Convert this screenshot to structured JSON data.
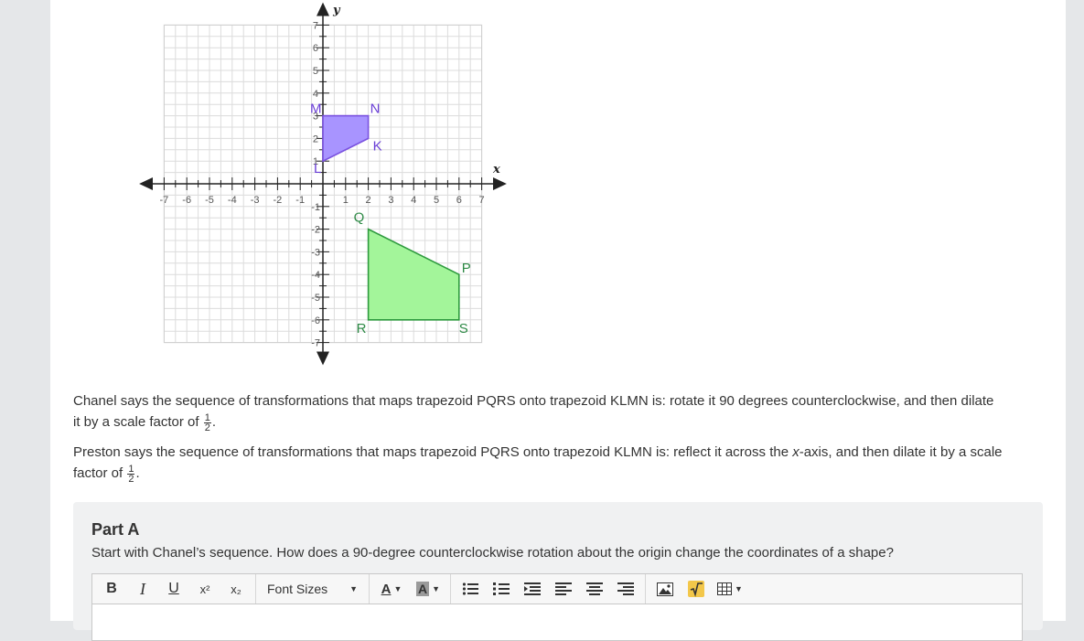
{
  "graph": {
    "axis_x_name": "x",
    "axis_y_name": "y",
    "x_ticks": [
      "-7",
      "-6",
      "-5",
      "-4",
      "-3",
      "-2",
      "-1",
      "1",
      "2",
      "3",
      "4",
      "5",
      "6",
      "7"
    ],
    "y_ticks_pos": [
      "1",
      "2",
      "3",
      "4",
      "5",
      "6",
      "7"
    ],
    "y_ticks_neg": [
      "-1",
      "-2",
      "-3",
      "-4",
      "-5",
      "-6",
      "-7"
    ],
    "shape_klmn": {
      "fill": "#a894ff",
      "stroke": "#7a52e0",
      "label_color": "#6a3fd6",
      "points": [
        {
          "label": "K",
          "x": 2,
          "y": 2
        },
        {
          "label": "L",
          "x": 0,
          "y": 1
        },
        {
          "label": "M",
          "x": 0,
          "y": 3
        },
        {
          "label": "N",
          "x": 2,
          "y": 3
        }
      ]
    },
    "shape_pqrs": {
      "fill": "#a3f59a",
      "stroke": "#2e9a3e",
      "label_color": "#2e8a46",
      "points": [
        {
          "label": "P",
          "x": 6,
          "y": -4
        },
        {
          "label": "Q",
          "x": 2,
          "y": -2
        },
        {
          "label": "R",
          "x": 2,
          "y": -6
        },
        {
          "label": "S",
          "x": 6,
          "y": -6
        }
      ]
    }
  },
  "chanel": {
    "line1": "Chanel says the sequence of transformations that maps trapezoid PQRS onto trapezoid KLMN is: rotate it 90 degrees counterclockwise, and then dilate",
    "line2_pre": "it by a scale factor of ",
    "frac_num": "1",
    "frac_den": "2",
    "line2_post": "."
  },
  "preston": {
    "line1_pre": "Preston says the sequence of transformations that maps trapezoid PQRS onto trapezoid KLMN is: reflect it across the ",
    "line1_var": "x",
    "line1_post": "-axis, and then dilate it by a scale",
    "line2_pre": "factor of ",
    "frac_num": "1",
    "frac_den": "2",
    "line2_post": "."
  },
  "partA": {
    "title": "Part A",
    "question": "Start with Chanel’s sequence. How does a 90-degree counterclockwise rotation about the origin change the coordinates of a shape?"
  },
  "toolbar": {
    "bold": "B",
    "italic": "I",
    "underline": "U",
    "superscript": "x²",
    "subscript": "x₂",
    "font_sizes": "Font Sizes",
    "font_color": "A",
    "bg_color": "A"
  }
}
